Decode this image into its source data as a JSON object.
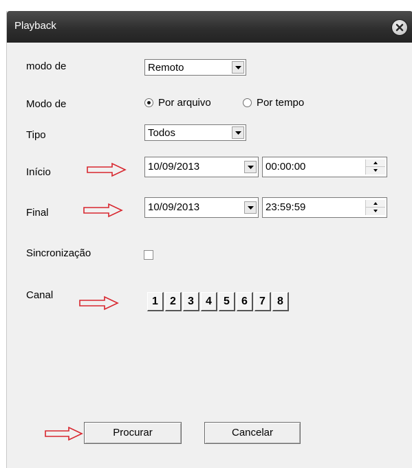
{
  "window": {
    "title": "Playback"
  },
  "form": {
    "modo_de_label": "modo de",
    "modo_de_value": "Remoto",
    "modo_de2_label": "Modo de",
    "radio_arquivo": "Por arquivo",
    "radio_tempo": "Por tempo",
    "tipo_label": "Tipo",
    "tipo_value": "Todos",
    "inicio_label": "Início",
    "inicio_date": "10/09/2013",
    "inicio_time": "00:00:00",
    "final_label": "Final",
    "final_date": "10/09/2013",
    "final_time": "23:59:59",
    "sinc_label": "Sincronização",
    "canal_label": "Canal",
    "channels": [
      "1",
      "2",
      "3",
      "4",
      "5",
      "6",
      "7",
      "8"
    ]
  },
  "buttons": {
    "search": "Procurar",
    "cancel": "Cancelar"
  },
  "colors": {
    "arrow": "#d8262e",
    "titlebar": "#2d2d2d"
  }
}
